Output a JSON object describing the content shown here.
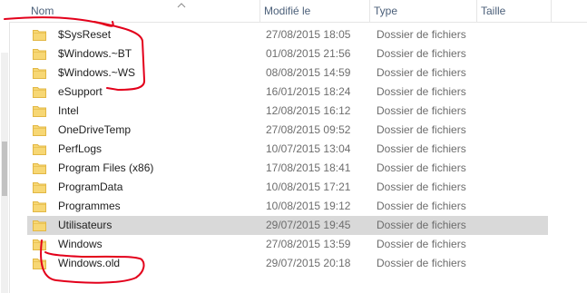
{
  "columns": {
    "name": "Nom",
    "modified": "Modifié le",
    "type": "Type",
    "size": "Taille"
  },
  "rows": [
    {
      "name": "$SysReset",
      "modified": "27/08/2015 18:05",
      "type": "Dossier de fichiers"
    },
    {
      "name": "$Windows.~BT",
      "modified": "01/08/2015 21:56",
      "type": "Dossier de fichiers"
    },
    {
      "name": "$Windows.~WS",
      "modified": "08/08/2015 14:59",
      "type": "Dossier de fichiers"
    },
    {
      "name": "eSupport",
      "modified": "16/01/2015 18:24",
      "type": "Dossier de fichiers"
    },
    {
      "name": "Intel",
      "modified": "12/08/2015 16:12",
      "type": "Dossier de fichiers"
    },
    {
      "name": "OneDriveTemp",
      "modified": "27/08/2015 09:52",
      "type": "Dossier de fichiers"
    },
    {
      "name": "PerfLogs",
      "modified": "10/07/2015 13:04",
      "type": "Dossier de fichiers"
    },
    {
      "name": "Program Files (x86)",
      "modified": "17/08/2015 18:41",
      "type": "Dossier de fichiers"
    },
    {
      "name": "ProgramData",
      "modified": "10/08/2015 17:21",
      "type": "Dossier de fichiers"
    },
    {
      "name": "Programmes",
      "modified": "10/08/2015 19:12",
      "type": "Dossier de fichiers"
    },
    {
      "name": "Utilisateurs",
      "modified": "29/07/2015 19:45",
      "type": "Dossier de fichiers",
      "selected": true
    },
    {
      "name": "Windows",
      "modified": "27/08/2015 13:59",
      "type": "Dossier de fichiers"
    },
    {
      "name": "Windows.old",
      "modified": "29/07/2015 20:18",
      "type": "Dossier de fichiers"
    }
  ],
  "colors": {
    "folder": "#f7d774",
    "folder_dark": "#e2b744",
    "annotation": "#e3001b",
    "selection": "#d9d9d9"
  },
  "icons": {
    "folder": "folder-icon",
    "sort": "sort-ascending-icon"
  }
}
